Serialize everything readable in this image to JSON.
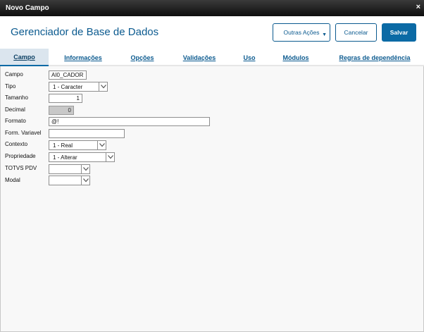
{
  "window": {
    "title": "Novo Campo",
    "close_glyph": "×"
  },
  "header": {
    "app_title": "Gerenciador de Base de Dados",
    "more_actions_label": "Outras Ações",
    "more_actions_caret": "▼",
    "cancel_label": "Cancelar",
    "save_label": "Salvar"
  },
  "tabs": [
    {
      "label": "Campo",
      "active": true
    },
    {
      "label": "Informações"
    },
    {
      "label": "Opções"
    },
    {
      "label": "Validações"
    },
    {
      "label": "Uso"
    },
    {
      "label": "Módulos"
    },
    {
      "label": "Regras de dependência"
    }
  ],
  "form": {
    "campo": {
      "label": "Campo",
      "value": "AI0_CADOR"
    },
    "tipo": {
      "label": "Tipo",
      "value": "1 - Caracter"
    },
    "tamanho": {
      "label": "Tamanho",
      "value": "1"
    },
    "decimal": {
      "label": "Decimal",
      "value": "0"
    },
    "formato": {
      "label": "Formato",
      "value": "@!"
    },
    "form_variavel": {
      "label": "Form. Variavel",
      "value": ""
    },
    "contexto": {
      "label": "Contexto",
      "value": "1 - Real"
    },
    "propriedade": {
      "label": "Propriedade",
      "value": "1 - Alterar"
    },
    "totvs_pdv": {
      "label": "TOTVS PDV",
      "value": ""
    },
    "modal": {
      "label": "Modal",
      "value": ""
    }
  },
  "colors": {
    "accent": "#0b5a8f",
    "primary_button": "#0b6aa5",
    "titlebar": "#1a1a1a",
    "active_tab": "#dbe5ee"
  },
  "icons": {
    "dropdown": "chevron-down-icon",
    "close": "close-icon"
  }
}
